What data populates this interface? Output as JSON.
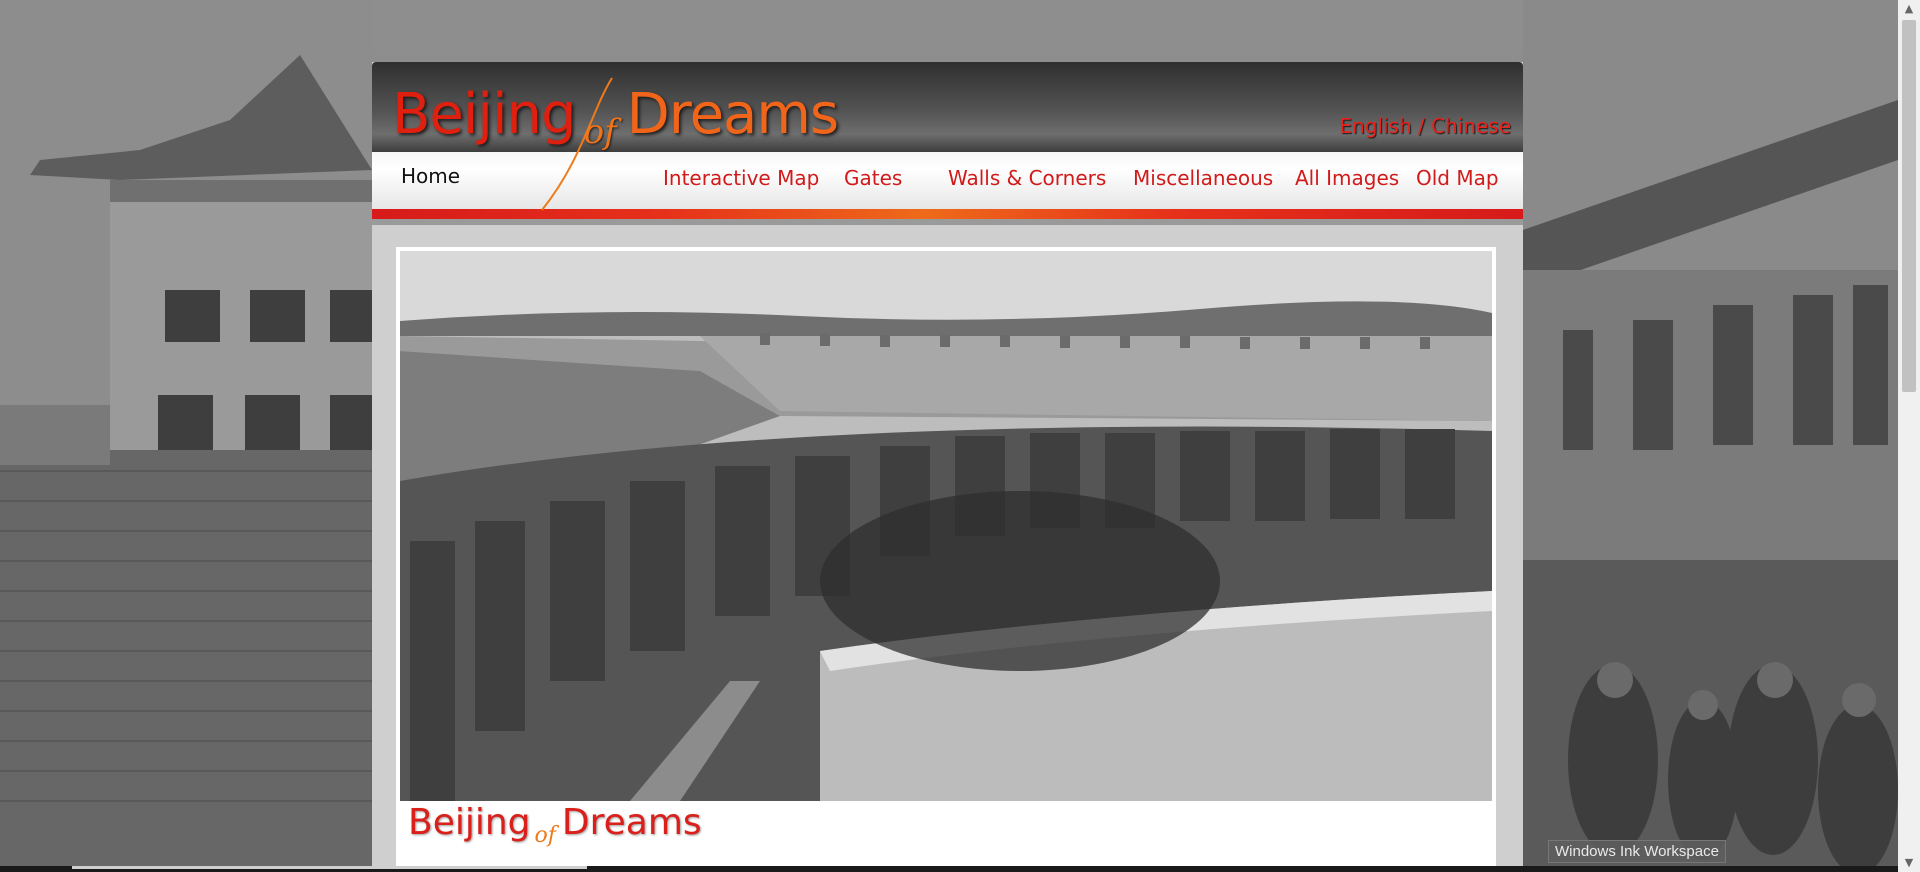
{
  "site": {
    "logo": {
      "word1": "Beijing",
      "of": "of",
      "word2": "Dreams"
    },
    "language": {
      "english": "English",
      "separator": " / ",
      "chinese": "Chinese"
    },
    "nav": [
      {
        "label": "Home",
        "active": true
      },
      {
        "label": "Interactive Map"
      },
      {
        "label": "Gates"
      },
      {
        "label": "Walls & Corners"
      },
      {
        "label": "Miscellaneous"
      },
      {
        "label": "All Images"
      },
      {
        "label": "Old Map"
      }
    ],
    "content": {
      "photo_subject": "city wall with crenellated battlements",
      "footer_logo": {
        "word1": "Beijing",
        "of": "of",
        "word2": "Dreams"
      }
    }
  },
  "browser": {
    "tooltip": "Windows Ink Workspace",
    "scroll_up_icon": "▲",
    "scroll_down_icon": "▼"
  },
  "colors": {
    "brand_red": "#e0200f",
    "brand_orange": "#f0651a",
    "nav_text": "#d11b1b"
  }
}
